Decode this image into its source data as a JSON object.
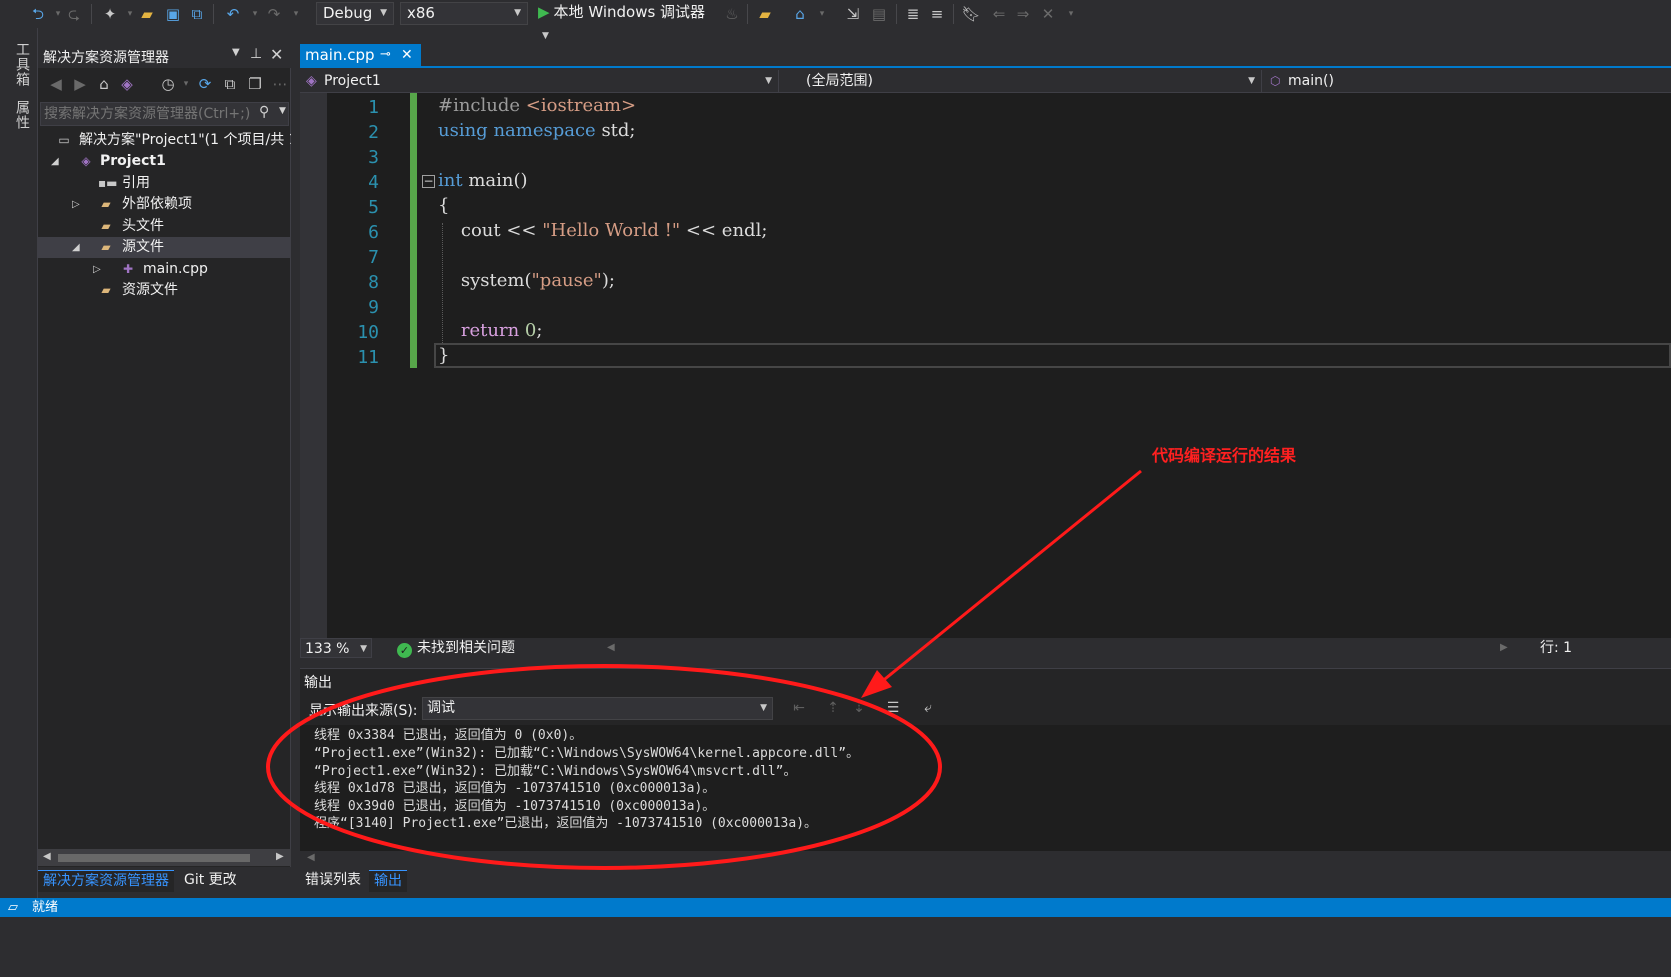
{
  "toolbar": {
    "config": "Debug",
    "platform": "x86",
    "run_label": "本地 Windows 调试器"
  },
  "left_strip": {
    "toolbox": "工具箱",
    "properties": "属性"
  },
  "solution_explorer": {
    "title": "解决方案资源管理器",
    "search_placeholder": "搜索解决方案资源管理器(Ctrl+;)",
    "tree": [
      {
        "label": "解决方案\"Project1\"(1 个项目/共 1"
      },
      {
        "label": "Project1"
      },
      {
        "label": "引用"
      },
      {
        "label": "外部依赖项"
      },
      {
        "label": "头文件"
      },
      {
        "label": "源文件"
      },
      {
        "label": "main.cpp"
      },
      {
        "label": "资源文件"
      }
    ],
    "bottom_tabs": [
      "解决方案资源管理器",
      "Git 更改"
    ]
  },
  "editor": {
    "tab": "main.cpp",
    "nav_project": "Project1",
    "nav_scope": "(全局范围)",
    "nav_member": "main()",
    "line_numbers": [
      "1",
      "2",
      "3",
      "4",
      "5",
      "6",
      "7",
      "8",
      "9",
      "10",
      "11"
    ],
    "code": {
      "l1_a": "#include ",
      "l1_b": "<iostream>",
      "l2_a": "using",
      "l2_b": " ",
      "l2_c": "namespace",
      "l2_d": " std;",
      "l4_a": "int",
      "l4_b": " main()",
      "l5": "{",
      "l6_a": "    cout << ",
      "l6_b": "\"Hello World !\"",
      "l6_c": " << endl;",
      "l8_a": "    system(",
      "l8_b": "\"pause\"",
      "l8_c": ");",
      "l10_a": "    ",
      "l10_b": "return",
      "l10_c": " ",
      "l10_d": "0",
      "l10_e": ";",
      "l11": "}"
    },
    "zoom": "133 %",
    "issues": "未找到相关问题",
    "line_col": "行: 1"
  },
  "output": {
    "title": "输出",
    "source_label": "显示输出来源(S):",
    "source_value": "调试",
    "lines": [
      "线程 0x3384 已退出，返回值为 0 (0x0)。",
      "“Project1.exe”(Win32): 已加载“C:\\Windows\\SysWOW64\\kernel.appcore.dll”。",
      "“Project1.exe”(Win32): 已加载“C:\\Windows\\SysWOW64\\msvcrt.dll”。",
      "线程 0x1d78 已退出，返回值为 -1073741510 (0xc000013a)。",
      "线程 0x39d0 已退出，返回值为 -1073741510 (0xc000013a)。",
      "程序“[3140] Project1.exe”已退出，返回值为 -1073741510 (0xc000013a)。"
    ],
    "tabs": [
      "错误列表",
      "输出"
    ]
  },
  "status_bar": {
    "text": "就绪"
  },
  "annotation": {
    "text": "代码编译运行的结果",
    "color": "#ff2020"
  },
  "colors": {
    "accent": "#007acc",
    "keyword": "#569cd6",
    "string": "#d69d85",
    "line_number": "#2b91af",
    "change_bar": "#57a64a"
  }
}
